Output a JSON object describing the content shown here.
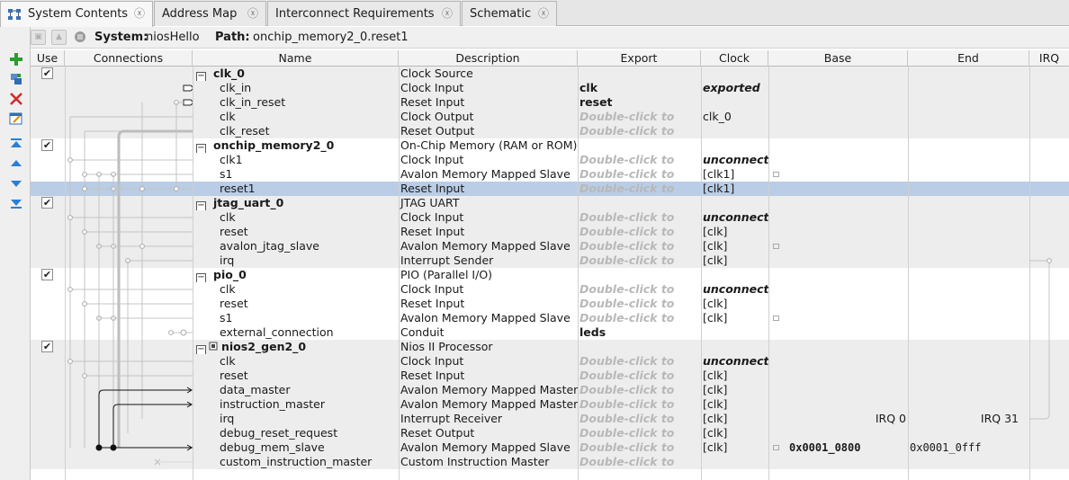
{
  "tabs": [
    {
      "label": "System Contents",
      "active": true,
      "icon": "system-contents-icon"
    },
    {
      "label": "Address Map",
      "active": false
    },
    {
      "label": "Interconnect Requirements",
      "active": false
    },
    {
      "label": "Schematic",
      "active": false
    }
  ],
  "tab_close_glyph": "ⓧ",
  "toolbar": {
    "add": "add-component-icon",
    "edit_system": "edit-system-icon",
    "remove": "remove-icon",
    "edit_params": "edit-parameters-icon",
    "move_top": "move-top-icon",
    "move_up": "move-up-icon",
    "move_down": "move-down-icon",
    "move_bottom": "move-bottom-icon"
  },
  "system_bar": {
    "system_label": "System:",
    "system_value": "niosHello",
    "path_label": "Path:",
    "path_value": "onchip_memory2_0.reset1"
  },
  "columns": [
    "Use",
    "Connections",
    "Name",
    "Description",
    "Export",
    "Clock",
    "Base",
    "End",
    "IRQ"
  ],
  "rows": [
    {
      "type": "module",
      "use": true,
      "name": "clk_0",
      "desc": "Clock Source",
      "export": "",
      "clock": "",
      "shade": "odd"
    },
    {
      "type": "port",
      "name": "clk_in",
      "desc": "Clock Input",
      "export": "clk",
      "export_style": "bold",
      "clock": "exported",
      "clock_style": "bold-italic",
      "shade": "odd"
    },
    {
      "type": "port",
      "name": "clk_in_reset",
      "desc": "Reset Input",
      "export": "reset",
      "export_style": "bold",
      "clock": "",
      "shade": "odd"
    },
    {
      "type": "port",
      "name": "clk",
      "desc": "Clock Output",
      "export": "Double-click to",
      "export_style": "hint",
      "clock": "clk_0",
      "shade": "odd"
    },
    {
      "type": "port",
      "name": "clk_reset",
      "desc": "Reset Output",
      "export": "Double-click to",
      "export_style": "hint",
      "clock": "",
      "shade": "odd"
    },
    {
      "type": "module",
      "use": true,
      "name": "onchip_memory2_0",
      "desc": "On-Chip Memory (RAM or ROM)",
      "export": "",
      "clock": "",
      "shade": "even"
    },
    {
      "type": "port",
      "name": "clk1",
      "desc": "Clock Input",
      "export": "Double-click to",
      "export_style": "hint",
      "clock": "unconnected",
      "clock_style": "bold-italic",
      "shade": "even"
    },
    {
      "type": "port",
      "name": "s1",
      "desc": "Avalon Memory Mapped Slave",
      "export": "Double-click to",
      "export_style": "hint",
      "clock": "[clk1]",
      "lock": true,
      "shade": "even"
    },
    {
      "type": "port",
      "name": "reset1",
      "desc": "Reset Input",
      "export": "Double-click to",
      "export_style": "hint",
      "clock": "[clk1]",
      "shade": "sel"
    },
    {
      "type": "module",
      "use": true,
      "name": "jtag_uart_0",
      "desc": "JTAG UART",
      "export": "",
      "clock": "",
      "shade": "odd"
    },
    {
      "type": "port",
      "name": "clk",
      "desc": "Clock Input",
      "export": "Double-click to",
      "export_style": "hint",
      "clock": "unconnected",
      "clock_style": "bold-italic",
      "shade": "odd"
    },
    {
      "type": "port",
      "name": "reset",
      "desc": "Reset Input",
      "export": "Double-click to",
      "export_style": "hint",
      "clock": "[clk]",
      "shade": "odd"
    },
    {
      "type": "port",
      "name": "avalon_jtag_slave",
      "desc": "Avalon Memory Mapped Slave",
      "export": "Double-click to",
      "export_style": "hint",
      "clock": "[clk]",
      "lock": true,
      "shade": "odd"
    },
    {
      "type": "port",
      "name": "irq",
      "desc": "Interrupt Sender",
      "export": "Double-click to",
      "export_style": "hint",
      "clock": "[clk]",
      "shade": "odd"
    },
    {
      "type": "module",
      "use": true,
      "name": "pio_0",
      "desc": "PIO (Parallel I/O)",
      "export": "",
      "clock": "",
      "shade": "even"
    },
    {
      "type": "port",
      "name": "clk",
      "desc": "Clock Input",
      "export": "Double-click to",
      "export_style": "hint",
      "clock": "unconnected",
      "clock_style": "bold-italic",
      "shade": "even"
    },
    {
      "type": "port",
      "name": "reset",
      "desc": "Reset Input",
      "export": "Double-click to",
      "export_style": "hint",
      "clock": "[clk]",
      "shade": "even"
    },
    {
      "type": "port",
      "name": "s1",
      "desc": "Avalon Memory Mapped Slave",
      "export": "Double-click to",
      "export_style": "hint",
      "clock": "[clk]",
      "lock": true,
      "shade": "even"
    },
    {
      "type": "port",
      "name": "external_connection",
      "desc": "Conduit",
      "export": "leds",
      "export_style": "bold",
      "clock": "",
      "shade": "even"
    },
    {
      "type": "module",
      "use": true,
      "name": "nios2_gen2_0",
      "desc": "Nios II Processor",
      "export": "",
      "clock": "",
      "shade": "odd",
      "proc_icon": true
    },
    {
      "type": "port",
      "name": "clk",
      "desc": "Clock Input",
      "export": "Double-click to",
      "export_style": "hint",
      "clock": "unconnected",
      "clock_style": "bold-italic",
      "shade": "odd"
    },
    {
      "type": "port",
      "name": "reset",
      "desc": "Reset Input",
      "export": "Double-click to",
      "export_style": "hint",
      "clock": "[clk]",
      "shade": "odd"
    },
    {
      "type": "port",
      "name": "data_master",
      "desc": "Avalon Memory Mapped Master",
      "export": "Double-click to",
      "export_style": "hint",
      "clock": "[clk]",
      "shade": "odd"
    },
    {
      "type": "port",
      "name": "instruction_master",
      "desc": "Avalon Memory Mapped Master",
      "export": "Double-click to",
      "export_style": "hint",
      "clock": "[clk]",
      "shade": "odd"
    },
    {
      "type": "port",
      "name": "irq",
      "desc": "Interrupt Receiver",
      "export": "Double-click to",
      "export_style": "hint",
      "clock": "[clk]",
      "irq_lo": "IRQ 0",
      "irq_hi": "IRQ 31",
      "shade": "odd"
    },
    {
      "type": "port",
      "name": "debug_reset_request",
      "desc": "Reset Output",
      "export": "Double-click to",
      "export_style": "hint",
      "clock": "[clk]",
      "shade": "odd"
    },
    {
      "type": "port",
      "name": "debug_mem_slave",
      "desc": "Avalon Memory Mapped Slave",
      "export": "Double-click to",
      "export_style": "hint",
      "clock": "[clk]",
      "lock": true,
      "base": "0x0001_0800",
      "end": "0x0001_0fff",
      "shade": "odd"
    },
    {
      "type": "port",
      "name": "custom_instruction_master",
      "desc": "Custom Instruction Master",
      "export": "Double-click to",
      "export_style": "hint",
      "clock": "",
      "shade": "odd"
    }
  ],
  "colors": {
    "selection": "#b9cde6",
    "row_alt": "#ededed",
    "hint_text": "#b8b8b8",
    "add_green": "#2a9d2a",
    "remove_red": "#d42b2b",
    "nav_blue": "#2a7fd4"
  }
}
